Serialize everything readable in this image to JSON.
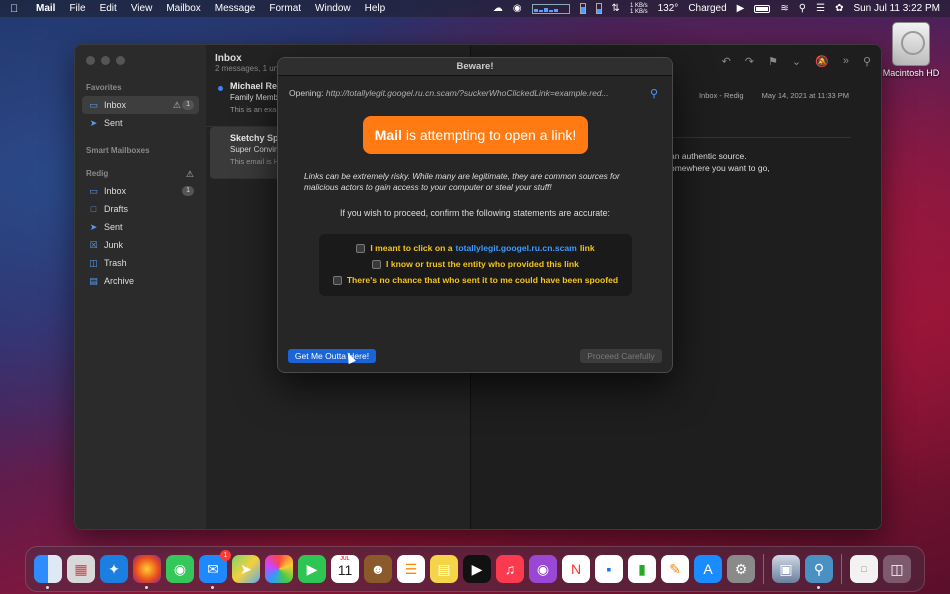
{
  "menubar": {
    "apple_icon": "apple-logo",
    "items": [
      "Mail",
      "File",
      "Edit",
      "View",
      "Mailbox",
      "Message",
      "Format",
      "Window",
      "Help"
    ],
    "net_up": "1 KB/s",
    "net_down": "1 KB/s",
    "temperature": "132°",
    "battery_status": "Charged",
    "datetime": "Sun Jul 11  3:22 PM"
  },
  "desktop": {
    "hd_label": "Macintosh HD"
  },
  "sidebar": {
    "favorites_label": "Favorites",
    "favorites": [
      {
        "label": "Inbox",
        "icon": "tray-icon",
        "count": "1"
      },
      {
        "label": "Sent",
        "icon": "paperplane-icon"
      }
    ],
    "smart_label": "Smart Mailboxes",
    "account_label": "Redig",
    "mailboxes": [
      {
        "label": "Inbox",
        "icon": "tray-icon",
        "count": "1"
      },
      {
        "label": "Drafts",
        "icon": "doc-icon"
      },
      {
        "label": "Sent",
        "icon": "paperplane-icon"
      },
      {
        "label": "Junk",
        "icon": "junk-icon"
      },
      {
        "label": "Trash",
        "icon": "trash-icon"
      },
      {
        "label": "Archive",
        "icon": "archive-icon"
      }
    ]
  },
  "message_list": {
    "title": "Inbox",
    "subtitle": "2 messages, 1 unre",
    "messages": [
      {
        "from": "Michael Red",
        "subject": "Family Membe",
        "preview": "This is an exa sarcasm). Per",
        "unread": true
      },
      {
        "from": "Sketchy Sp",
        "subject": "Super Convin",
        "preview": "This email is Here's a link t",
        "unread": false
      }
    ]
  },
  "reader": {
    "mailbox_tag": "Inbox - Redig",
    "date": "May 14, 2021 at 11:33 PM",
    "body_line1": "an authentic source.",
    "body_line2": "omewhere you want to go,"
  },
  "dialog": {
    "title": "Beware!",
    "opening_label": "Opening:",
    "opening_url": "http://totallylegit.googel.ru.cn.scam/?suckerWhoClickedLink=example.red...",
    "alert_app": "Mail",
    "alert_text": " is attempting to open a link!",
    "warning": "Links can be extremely risky. While many are legitimate, they are common sources for malicious actors to gain access to your computer or steal your stuff!",
    "instruction": "If you wish to proceed, confirm the following statements are accurate:",
    "check1_pre": "I meant to click on a",
    "check1_link": "totallylegit.googel.ru.cn.scam",
    "check1_post": "link",
    "check2": "I know or trust the entity who provided this link",
    "check3": "There's no chance that who sent it to me could have been spoofed",
    "escape_button": "Get Me Outta Here!",
    "proceed_button": "Proceed Carefully"
  },
  "dock": {
    "mail_badge": "1",
    "calendar_month": "JUL",
    "calendar_day": "11"
  }
}
